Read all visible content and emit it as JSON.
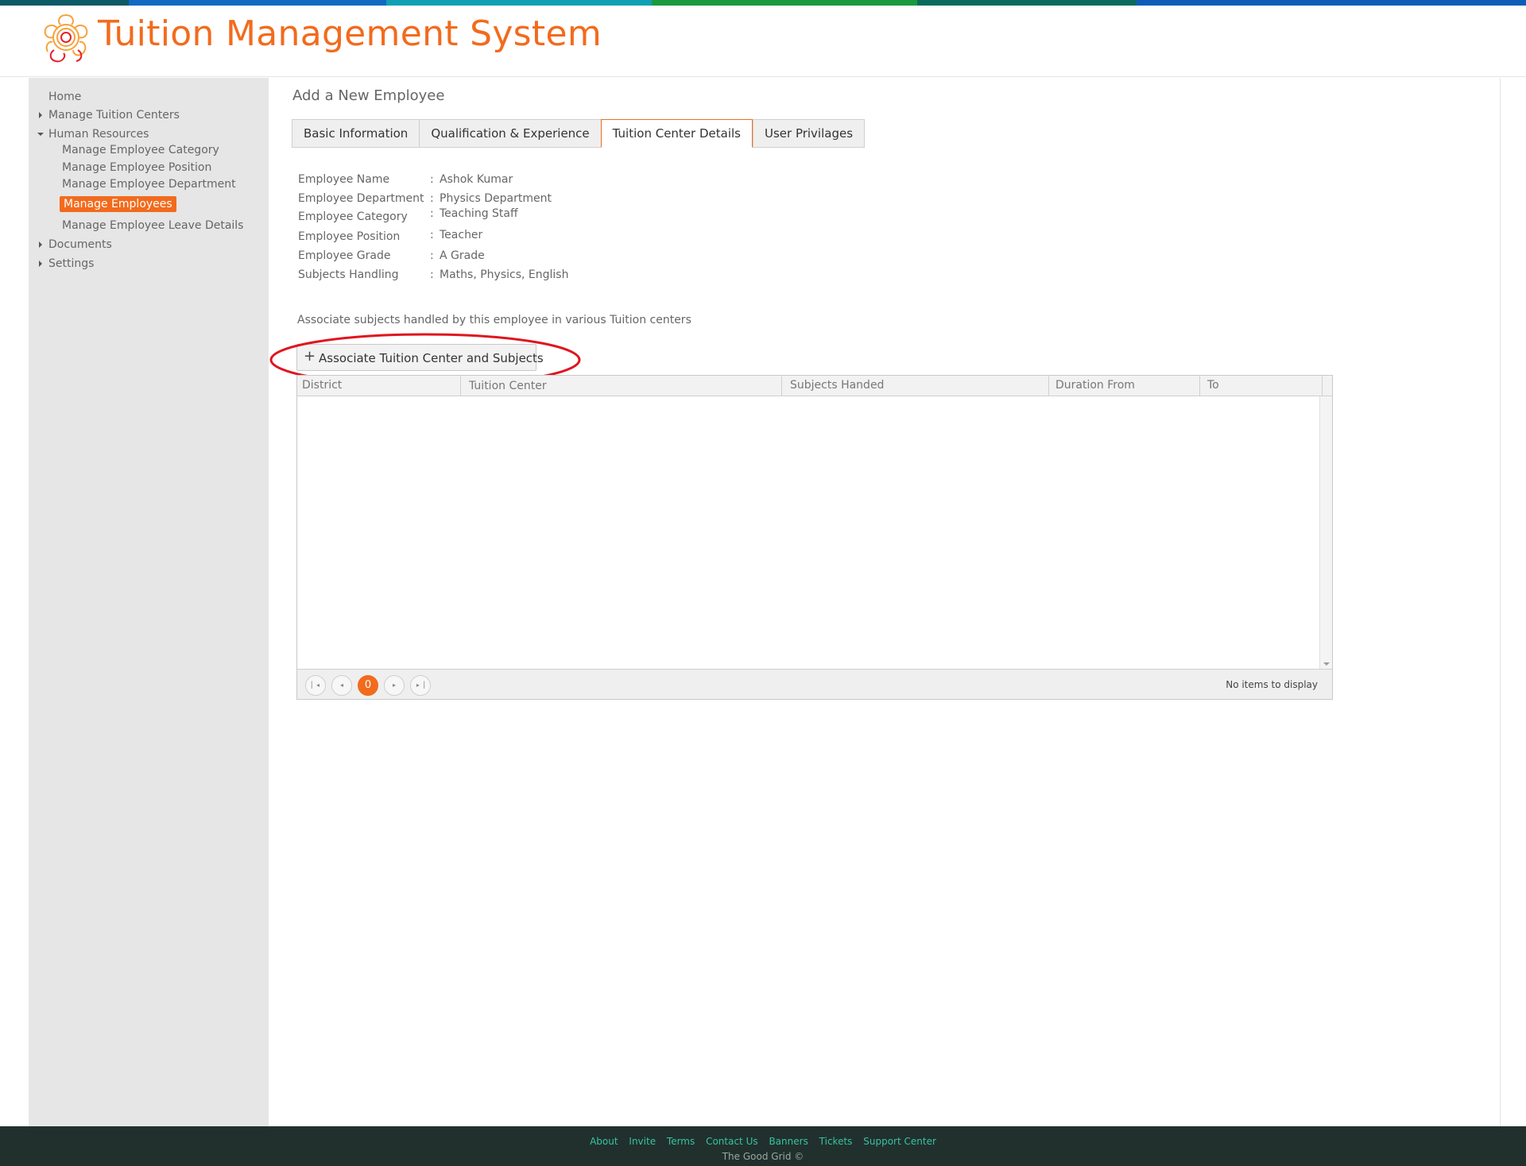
{
  "colors": {
    "accent": "#f26b1d",
    "top_strip": [
      "#0c5a66",
      "#1169c2",
      "#0fa0b4",
      "#1a9a3e",
      "#0a6b5c",
      "#0b5db8"
    ],
    "footer_bg": "#21302c",
    "footer_link": "#37c3a5",
    "highlight_ring": "#e0141f"
  },
  "header": {
    "logo_icon": "flower-logo-icon",
    "title": "Tuition Management System"
  },
  "sidebar": {
    "items": [
      {
        "label": "Home",
        "caret": "none"
      },
      {
        "label": "Manage Tuition Centers",
        "caret": "right"
      },
      {
        "label": "Human Resources",
        "caret": "down"
      },
      {
        "label": "Manage Employee Category",
        "caret": "none"
      },
      {
        "label": "Manage Employee Position",
        "caret": "none"
      },
      {
        "label": "Manage Employee Department",
        "caret": "none"
      },
      {
        "label": "Manage Employees",
        "caret": "none",
        "active": true
      },
      {
        "label": "Manage Employee Leave Details",
        "caret": "none"
      },
      {
        "label": "Documents",
        "caret": "right"
      },
      {
        "label": "Settings",
        "caret": "right"
      }
    ]
  },
  "main": {
    "page_title": "Add a New Employee",
    "tabs": [
      {
        "label": "Basic Information"
      },
      {
        "label": "Qualification & Experience"
      },
      {
        "label": "Tuition Center Details",
        "active": true
      },
      {
        "label": "User Privilages"
      }
    ],
    "details": [
      {
        "label": "Employee Name",
        "value": "Ashok Kumar"
      },
      {
        "label": "Employee Department",
        "value": "Physics Department"
      },
      {
        "label": "Employee Category",
        "value": "Teaching Staff"
      },
      {
        "label": "Employee Position",
        "value": "Teacher"
      },
      {
        "label": "Employee Grade",
        "value": "A Grade"
      },
      {
        "label": "Subjects Handling",
        "value": "Maths, Physics, English"
      }
    ],
    "separator": ":",
    "assoc_note": "Associate subjects handled by this employee in various Tuition centers",
    "assoc_button": {
      "icon": "plus-icon",
      "label": "Associate Tuition Center and Subjects"
    },
    "grid": {
      "columns": [
        "District",
        "Tuition Center",
        "Subjects Handed",
        "Duration From",
        "To"
      ],
      "rows": [],
      "pager": {
        "first_icon": "first-page-icon",
        "prev_icon": "previous-page-icon",
        "current_page": "0",
        "next_icon": "next-page-icon",
        "last_icon": "last-page-icon",
        "info": "No items to display"
      }
    }
  },
  "footer": {
    "links": [
      "About",
      "Invite",
      "Terms",
      "Contact Us",
      "Banners",
      "Tickets",
      "Support Center"
    ],
    "copyright": "The Good Grid ©"
  }
}
